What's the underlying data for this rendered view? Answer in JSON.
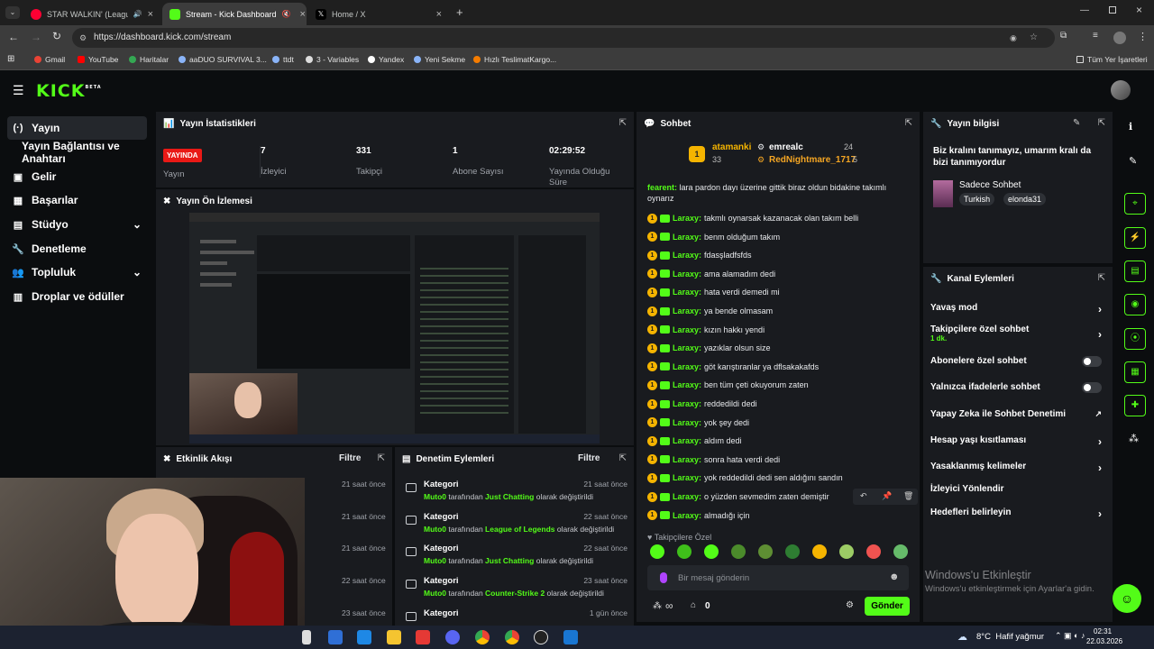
{
  "browser": {
    "tabs": [
      {
        "title": "STAR WALKIN' (League of L",
        "color": "#ff0033"
      },
      {
        "title": "Stream - Kick Dashboard",
        "color": "#53fc18"
      },
      {
        "title": "Home / X",
        "color": "#000000"
      }
    ],
    "url": "https://dashboard.kick.com/stream",
    "bookmarks": [
      "Gmail",
      "YouTube",
      "Haritalar",
      "aaDUO SURVIVAL 3...",
      "ttdt",
      "3 - Variables",
      "Yandex",
      "Yeni Sekme",
      "Hızlı TeslimatKargo..."
    ],
    "all_bookmarks": "Tüm Yer İşaretleri"
  },
  "kick": {
    "logo": "KICK",
    "logo_tag": "BETA",
    "accent": "#53fc18"
  },
  "sidebar": {
    "items": [
      {
        "label": "Yayın",
        "icon": "broadcast-icon"
      },
      {
        "label": "Yayın Bağlantısı ve Anahtarı",
        "icon": ""
      },
      {
        "label": "Gelir",
        "icon": "wallet-icon"
      },
      {
        "label": "Başarılar",
        "icon": "trophy-icon"
      },
      {
        "label": "Stüdyo",
        "icon": "studio-icon"
      },
      {
        "label": "Denetleme",
        "icon": "wrench-icon"
      },
      {
        "label": "Topluluk",
        "icon": "users-icon"
      },
      {
        "label": "Droplar ve ödüller",
        "icon": "gift-icon"
      }
    ]
  },
  "stats": {
    "title": "Yayın İstatistikleri",
    "live_badge": "YAYINDA",
    "live_label": "Yayın",
    "items": [
      {
        "value": "7",
        "label": "İzleyici"
      },
      {
        "value": "331",
        "label": "Takipçi"
      },
      {
        "value": "1",
        "label": "Abone Sayısı"
      },
      {
        "value": "02:29:52",
        "label": "Yayında Olduğu Süre"
      }
    ]
  },
  "preview": {
    "title": "Yayın Ön İzlemesi"
  },
  "activity": {
    "title": "Etkinlik Akışı",
    "filter": "Filtre",
    "times": [
      "21 saat önce",
      "21 saat önce",
      "21 saat önce",
      "22 saat önce",
      "23 saat önce"
    ]
  },
  "mod_actions": {
    "title": "Denetim Eylemleri",
    "filter": "Filtre",
    "items": [
      {
        "title": "Kategori",
        "by": "Muto0",
        "mid": " tarafından ",
        "cat": "Just Chatting",
        "end": " olarak değiştirildi",
        "time": "21 saat önce"
      },
      {
        "title": "Kategori",
        "by": "Muto0",
        "mid": " tarafından ",
        "cat": "League of Legends",
        "end": " olarak değiştirildi",
        "time": "22 saat önce"
      },
      {
        "title": "Kategori",
        "by": "Muto0",
        "mid": " tarafından ",
        "cat": "Just Chatting",
        "end": " olarak değiştirildi",
        "time": "22 saat önce"
      },
      {
        "title": "Kategori",
        "by": "Muto0",
        "mid": " tarafından ",
        "cat": "Counter-Strike 2",
        "end": " olarak değiştirildi",
        "time": "23 saat önce"
      },
      {
        "title": "Kategori",
        "by": "",
        "mid": "",
        "cat": "",
        "end": "",
        "time": "1 gün önce"
      }
    ]
  },
  "chat": {
    "title": "Sohbet",
    "leaderboard": {
      "rank": "1",
      "first": {
        "name": "atamanki",
        "count": "33"
      },
      "second": {
        "name": "emrealc",
        "count": "24"
      },
      "third": {
        "name": "RedNightmare_1717",
        "count": "5"
      }
    },
    "first_message": {
      "user": "fearent:",
      "text": " lara pardon dayı üzerine gittik biraz oldun bidakine takımlı oynarız"
    },
    "messages": [
      {
        "user": "Laraxy:",
        "text": "takmlı oynarsak kazanacak olan takım belli"
      },
      {
        "user": "Laraxy:",
        "text": "benm olduğum takım"
      },
      {
        "user": "Laraxy:",
        "text": "fdasşladfsfds"
      },
      {
        "user": "Laraxy:",
        "text": "ama alamadım dedi"
      },
      {
        "user": "Laraxy:",
        "text": "hata verdi demedi mi"
      },
      {
        "user": "Laraxy:",
        "text": "ya bende olmasam"
      },
      {
        "user": "Laraxy:",
        "text": "kızın hakkı yendi"
      },
      {
        "user": "Laraxy:",
        "text": "yazıklar olsun size"
      },
      {
        "user": "Laraxy:",
        "text": "göt karıştıranlar ya dflsakakafds"
      },
      {
        "user": "Laraxy:",
        "text": "ben tüm çeti okuyorum zaten"
      },
      {
        "user": "Laraxy:",
        "text": "reddedildi dedi"
      },
      {
        "user": "Laraxy:",
        "text": "yok şey dedi"
      },
      {
        "user": "Laraxy:",
        "text": "aldım dedi"
      },
      {
        "user": "Laraxy:",
        "text": "sonra hata verdi dedi"
      },
      {
        "user": "Laraxy:",
        "text": "yok reddedildi dedi sen aldığını sandın"
      },
      {
        "user": "Laraxy:",
        "text": "o yüzden sevmedim zaten demiştir"
      },
      {
        "user": "Laraxy:",
        "text": "almadığı için"
      }
    ],
    "followers_only": "Takipçilere Özel",
    "input_placeholder": "Bir mesaj gönderin",
    "points": "∞",
    "gift_count": "0",
    "send": "Gönder"
  },
  "stream_info": {
    "title": "Yayın bilgisi",
    "stream_title": "Biz kralını tanımayız, umarım kralı da bizi tanımıyordur",
    "category": "Sadece Sohbet",
    "tags": [
      "Turkish",
      "elonda31"
    ]
  },
  "channel_actions": {
    "title": "Kanal Eylemleri",
    "items": [
      {
        "label": "Yavaş mod",
        "control": "chevron"
      },
      {
        "label": "Takipçilere özel sohbet",
        "sub": "1 dk.",
        "control": "chevron"
      },
      {
        "label": "Abonelere özel sohbet",
        "control": "toggle"
      },
      {
        "label": "Yalnızca ifadelerle sohbet",
        "control": "toggle"
      },
      {
        "label": "Yapay Zeka ile Sohbet Denetimi",
        "control": "external"
      },
      {
        "label": "Hesap yaşı kısıtlaması",
        "control": "chevron"
      },
      {
        "label": "Yasaklanmış kelimeler",
        "control": "chevron"
      },
      {
        "label": "İzleyici Yönlendir",
        "control": "none"
      },
      {
        "label": "Hedefleri belirleyin",
        "control": "chevron"
      }
    ]
  },
  "windows": {
    "activate_title": "Windows'u Etkinleştir",
    "activate_sub": "Windows'u etkinleştirmek için Ayarlar'a gidin.",
    "weather": "8°C  Hafif yağmur",
    "time": "02:31",
    "date": "22.03.2026"
  }
}
